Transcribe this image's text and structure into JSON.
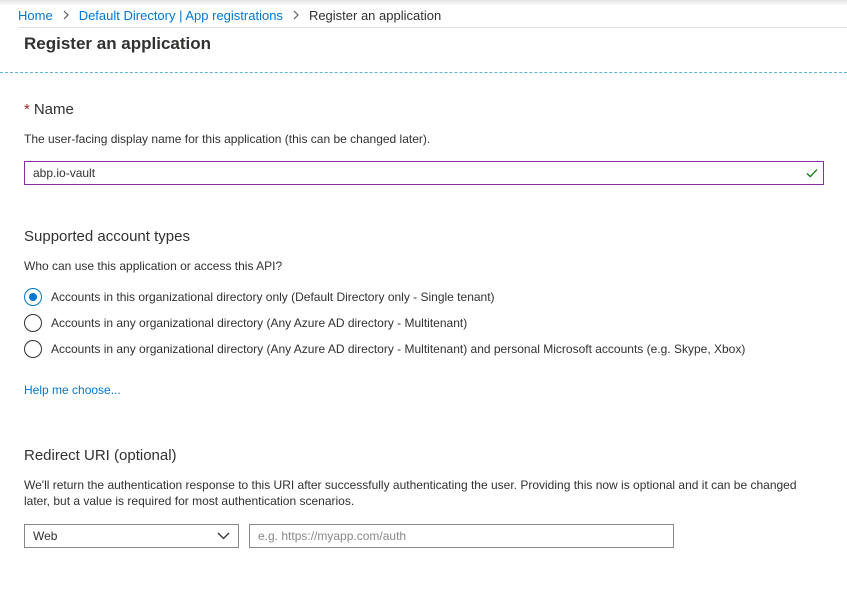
{
  "breadcrumb": {
    "home": "Home",
    "directory": "Default Directory | App registrations",
    "current": "Register an application"
  },
  "page": {
    "title": "Register an application"
  },
  "name_section": {
    "required_marker": "*",
    "title": "Name",
    "description": "The user-facing display name for this application (this can be changed later).",
    "value": "abp.io-vault",
    "valid_icon": "checkmark-icon"
  },
  "account_types": {
    "title": "Supported account types",
    "question": "Who can use this application or access this API?",
    "options": [
      {
        "label": "Accounts in this organizational directory only (Default Directory only - Single tenant)",
        "selected": true
      },
      {
        "label": "Accounts in any organizational directory (Any Azure AD directory - Multitenant)",
        "selected": false
      },
      {
        "label": "Accounts in any organizational directory (Any Azure AD directory - Multitenant) and personal Microsoft accounts (e.g. Skype, Xbox)",
        "selected": false
      }
    ],
    "help_link": "Help me choose..."
  },
  "redirect": {
    "title": "Redirect URI (optional)",
    "description": "We'll return the authentication response to this URI after successfully authenticating the user. Providing this now is optional and it can be changed later, but a value is required for most authentication scenarios.",
    "platform_selected": "Web",
    "uri_value": "",
    "uri_placeholder": "e.g. https://myapp.com/auth"
  },
  "colors": {
    "accent": "#0078d4",
    "focus_border": "#8a2da5",
    "valid": "#107c10",
    "required": "#a4262c",
    "divider": "#59b4d9"
  }
}
